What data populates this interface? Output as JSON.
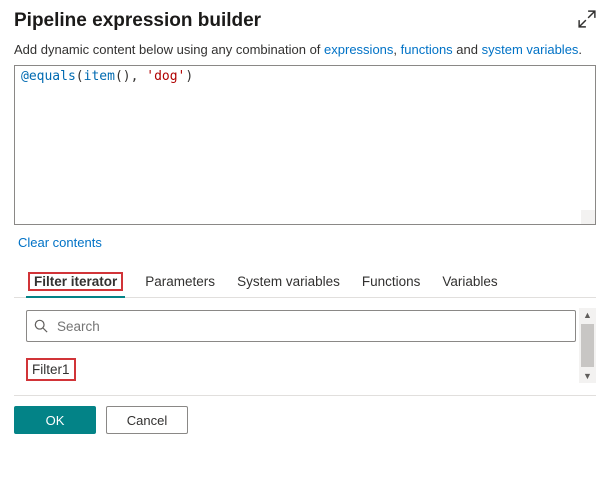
{
  "header": {
    "title": "Pipeline expression builder"
  },
  "subtitle": {
    "prefix": "Add dynamic content below using any combination of ",
    "link1": "expressions",
    "sep1": ", ",
    "link2": "functions",
    "sep2": " and ",
    "link3": "system variables",
    "suffix": "."
  },
  "editor": {
    "tok_at": "@equals",
    "tok_p1": "(",
    "tok_fn": "item",
    "tok_p2": "(), ",
    "tok_str": "'dog'",
    "tok_p3": ")"
  },
  "clear_label": "Clear contents",
  "tabs": {
    "filter_iterator": "Filter iterator",
    "parameters": "Parameters",
    "system_variables": "System variables",
    "functions": "Functions",
    "variables": "Variables"
  },
  "search": {
    "placeholder": "Search"
  },
  "list": {
    "item1": "Filter1"
  },
  "buttons": {
    "ok": "OK",
    "cancel": "Cancel"
  }
}
